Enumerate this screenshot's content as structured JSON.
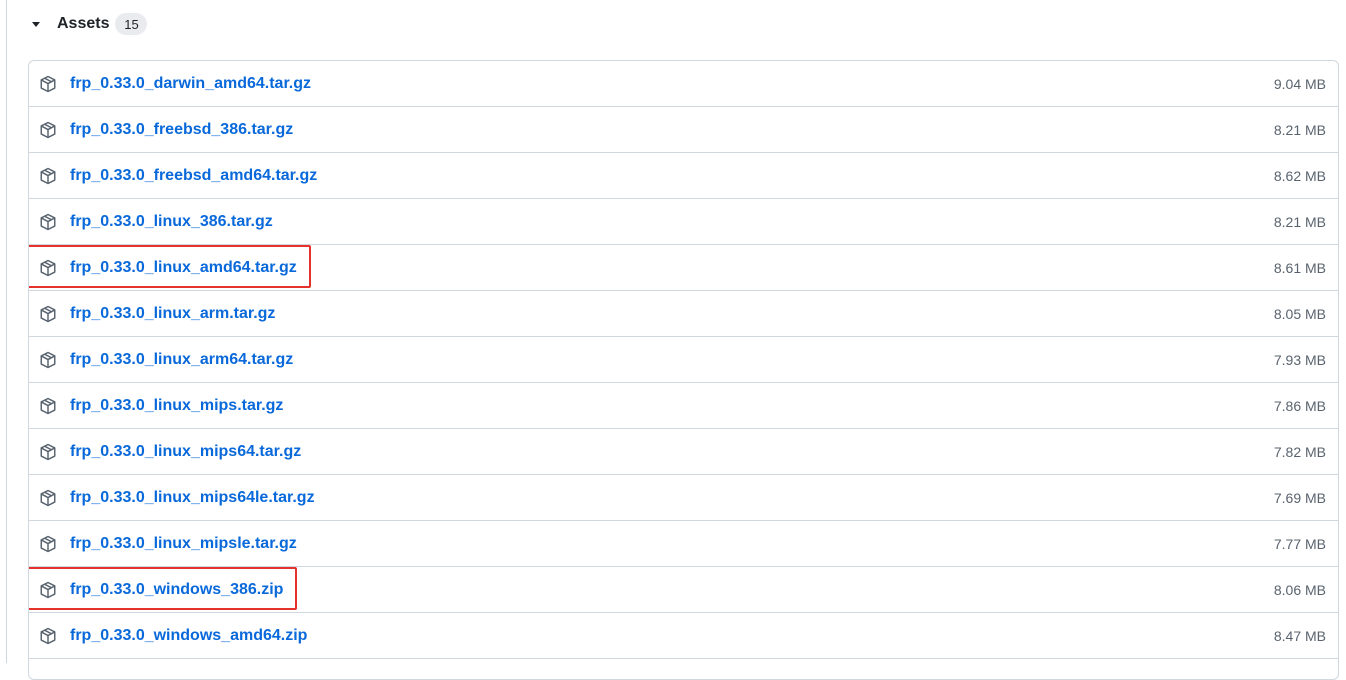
{
  "assets": {
    "title": "Assets",
    "count": "15",
    "items": [
      {
        "name": "frp_0.33.0_darwin_amd64.tar.gz",
        "size": "9.04 MB",
        "highlighted": false
      },
      {
        "name": "frp_0.33.0_freebsd_386.tar.gz",
        "size": "8.21 MB",
        "highlighted": false
      },
      {
        "name": "frp_0.33.0_freebsd_amd64.tar.gz",
        "size": "8.62 MB",
        "highlighted": false
      },
      {
        "name": "frp_0.33.0_linux_386.tar.gz",
        "size": "8.21 MB",
        "highlighted": false
      },
      {
        "name": "frp_0.33.0_linux_amd64.tar.gz",
        "size": "8.61 MB",
        "highlighted": true
      },
      {
        "name": "frp_0.33.0_linux_arm.tar.gz",
        "size": "8.05 MB",
        "highlighted": false
      },
      {
        "name": "frp_0.33.0_linux_arm64.tar.gz",
        "size": "7.93 MB",
        "highlighted": false
      },
      {
        "name": "frp_0.33.0_linux_mips.tar.gz",
        "size": "7.86 MB",
        "highlighted": false
      },
      {
        "name": "frp_0.33.0_linux_mips64.tar.gz",
        "size": "7.82 MB",
        "highlighted": false
      },
      {
        "name": "frp_0.33.0_linux_mips64le.tar.gz",
        "size": "7.69 MB",
        "highlighted": false
      },
      {
        "name": "frp_0.33.0_linux_mipsle.tar.gz",
        "size": "7.77 MB",
        "highlighted": false
      },
      {
        "name": "frp_0.33.0_windows_386.zip",
        "size": "8.06 MB",
        "highlighted": true
      },
      {
        "name": "frp_0.33.0_windows_amd64.zip",
        "size": "8.47 MB",
        "highlighted": false
      }
    ]
  },
  "icons": {
    "row_icon": "package-icon",
    "toggle_icon": "triangle-down-icon"
  },
  "colors": {
    "link": "#0969da",
    "highlight": "#e5322d",
    "border": "#d0d7de",
    "muted": "#59636e"
  }
}
